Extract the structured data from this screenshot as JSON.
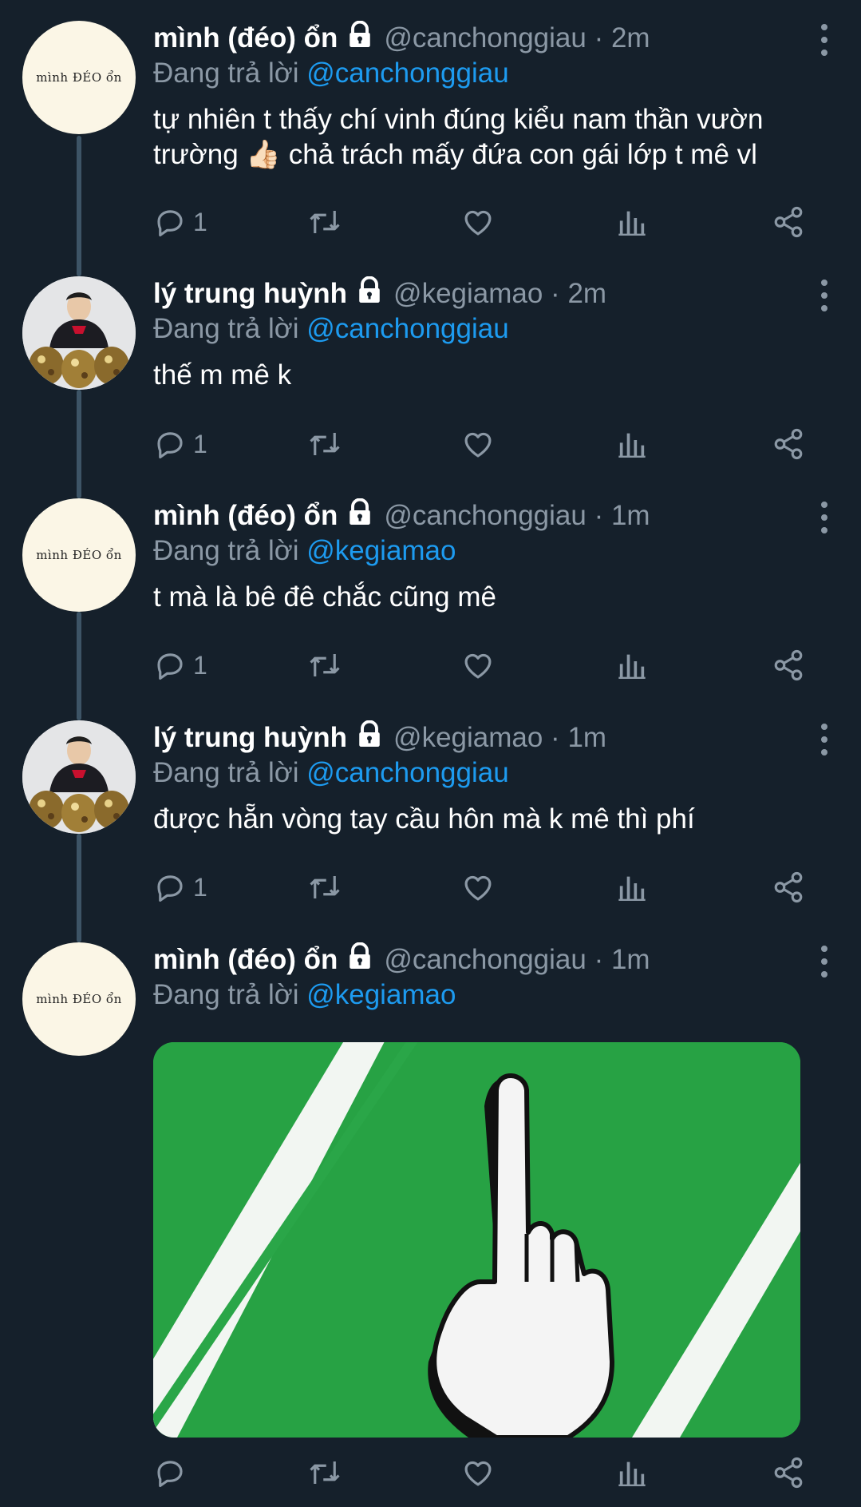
{
  "colors": {
    "background": "#15202b",
    "text": "#ffffff",
    "secondary": "#8b98a5",
    "mention": "#1d9bf0",
    "thread_line": "#3d5466"
  },
  "tweets": [
    {
      "name": "mình (đéo) ổn",
      "avatar_text": "mình ĐÉO ổn",
      "handle_time": "@canchonggiau · 2m",
      "replying_prefix": "Đang trả lời",
      "replying_to": "@canchonggiau",
      "text_lines": [
        "tự nhiên t thấy chí vinh đúng kiểu nam thần vườn",
        "trường 👍🏻 chả trách mấy đứa con gái lớp t mê vl"
      ],
      "reply_count": "1"
    },
    {
      "name": "lý trung huỳnh",
      "handle_time": "@kegiamao · 2m",
      "replying_prefix": "Đang trả lời",
      "replying_to": "@canchonggiau",
      "text_lines": [
        "thế m mê k"
      ],
      "reply_count": "1"
    },
    {
      "name": "mình (đéo) ổn",
      "avatar_text": "mình ĐÉO ổn",
      "handle_time": "@canchonggiau · 1m",
      "replying_prefix": "Đang trả lời",
      "replying_to": "@kegiamao",
      "text_lines": [
        "t mà là bê đê chắc cũng mê"
      ],
      "reply_count": "1"
    },
    {
      "name": "lý trung huỳnh",
      "handle_time": "@kegiamao · 1m",
      "replying_prefix": "Đang trả lời",
      "replying_to": "@canchonggiau",
      "text_lines": [
        "được hẵn vòng tay cầu hôn mà k mê thì phí"
      ],
      "reply_count": "1"
    },
    {
      "name": "mình (đéo) ổn",
      "avatar_text": "mình ĐÉO ổn",
      "handle_time": "@canchonggiau · 1m",
      "replying_prefix": "Đang trả lời",
      "replying_to": "@kegiamao",
      "media": "middle-finger-card-image",
      "reply_count": ""
    }
  ]
}
